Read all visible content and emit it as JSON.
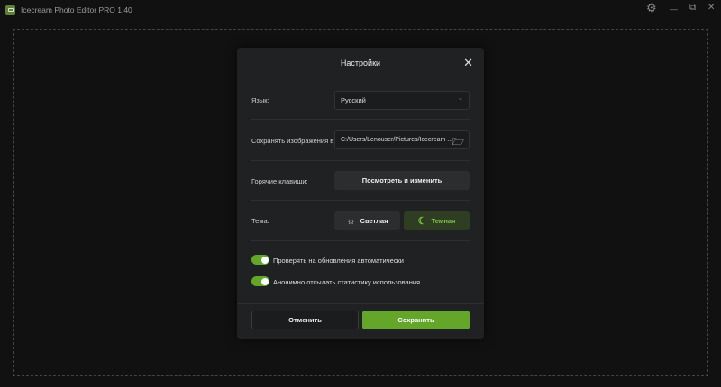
{
  "app": {
    "title": "Icecream Photo Editor PRO 1.40"
  },
  "window": {
    "settings_icon": "⚙",
    "minimize_icon": "—",
    "restore_icon": "⧉",
    "close_icon": "✕"
  },
  "dialog": {
    "title": "Настройки",
    "close_icon": "✕",
    "language": {
      "label": "Язык:",
      "value": "Русский",
      "chevron": "⌄"
    },
    "save_path": {
      "label": "Сохранять изображения в:",
      "value": "C:/Users/Lenouser/Pictures/Icecream ...",
      "folder_icon": "🗁"
    },
    "hotkeys": {
      "label": "Горячие клавиши:",
      "button": "Посмотреть и изменить"
    },
    "theme": {
      "label": "Тема:",
      "light": "Светлая",
      "dark": "Темная",
      "light_icon": "☼",
      "dark_icon": "☾",
      "selected": "dark"
    },
    "toggles": [
      {
        "label": "Проверять на обновления автоматически",
        "on": true
      },
      {
        "label": "Анонимно отсылать статистику использования",
        "on": true
      }
    ],
    "cancel": "Отменить",
    "save": "Сохранить"
  },
  "colors": {
    "accent": "#63a62a",
    "dark_selected_bg": "#2f3d22",
    "dark_selected_text": "#7bc142"
  }
}
